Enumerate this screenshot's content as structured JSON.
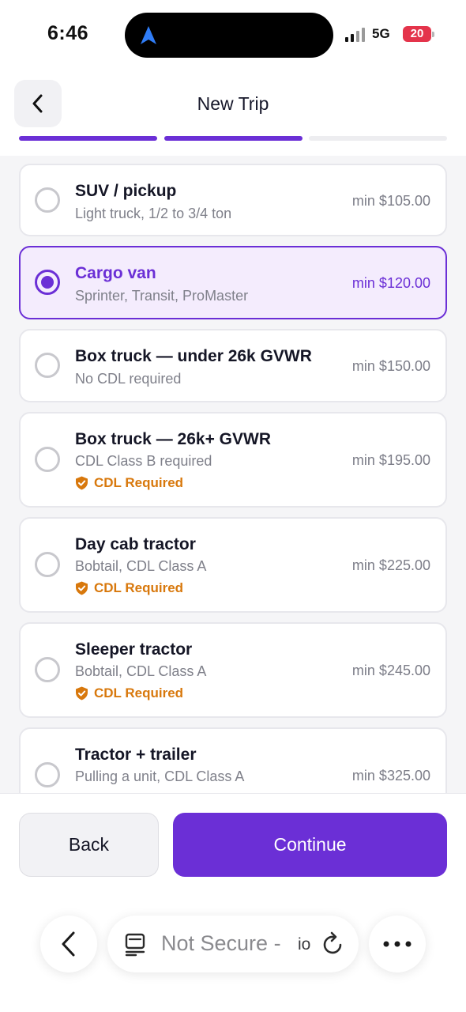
{
  "status_bar": {
    "time": "6:46",
    "network": "5G",
    "battery": "20"
  },
  "header": {
    "title": "New Trip",
    "progress": {
      "total_steps": 3,
      "completed_steps": 2
    }
  },
  "vehicles": [
    {
      "title": "SUV / pickup",
      "subtitle": "Light truck, 1/2 to 3/4 ton",
      "price": "min $105.00",
      "selected": false,
      "cdl": false
    },
    {
      "title": "Cargo van",
      "subtitle": "Sprinter, Transit, ProMaster",
      "price": "min $120.00",
      "selected": true,
      "cdl": false
    },
    {
      "title": "Box truck — under 26k GVWR",
      "subtitle": "No CDL required",
      "price": "min $150.00",
      "selected": false,
      "cdl": false
    },
    {
      "title": "Box truck — 26k+ GVWR",
      "subtitle": "CDL Class B required",
      "price": "min $195.00",
      "selected": false,
      "cdl": true,
      "cdl_label": "CDL Required"
    },
    {
      "title": "Day cab tractor",
      "subtitle": "Bobtail, CDL Class A",
      "price": "min $225.00",
      "selected": false,
      "cdl": true,
      "cdl_label": "CDL Required"
    },
    {
      "title": "Sleeper tractor",
      "subtitle": "Bobtail, CDL Class A",
      "price": "min $245.00",
      "selected": false,
      "cdl": true,
      "cdl_label": "CDL Required"
    },
    {
      "title": "Tractor + trailer",
      "subtitle": "Pulling a unit, CDL Class A",
      "price": "min $325.00",
      "selected": false,
      "cdl": false
    }
  ],
  "footer": {
    "back_label": "Back",
    "continue_label": "Continue"
  },
  "browser": {
    "url_text": "Not Secure -",
    "url_tail": "io"
  },
  "icons": {
    "status_nav": "location-arrow-icon",
    "header_back": "chevron-left-icon",
    "cdl": "shield-check-icon",
    "browser_back": "chevron-left-icon",
    "page": "page-info-icon",
    "reload": "reload-icon",
    "more": "more-dots-icon"
  },
  "colors": {
    "accent": "#6b2fd6",
    "selected_bg": "#f4ecfd",
    "cdl_warning": "#d8780c",
    "battery_low": "#e4344b"
  }
}
